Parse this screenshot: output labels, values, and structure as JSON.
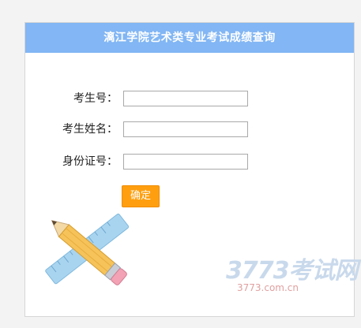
{
  "header": {
    "title": "漓江学院艺术类专业考试成绩查询"
  },
  "form": {
    "exam_no_label": "考生号：",
    "exam_no_value": "",
    "name_label": "考生姓名：",
    "name_value": "",
    "id_label": "身份证号：",
    "id_value": "",
    "submit_label": "确定"
  },
  "watermark": {
    "brand": "3773考试网",
    "url": "3773.com.cn"
  },
  "colors": {
    "header_bg": "#82b6f4",
    "button_bg": "#ff9f0f"
  },
  "icons": {
    "decoration": "pencil-ruler-icon"
  }
}
